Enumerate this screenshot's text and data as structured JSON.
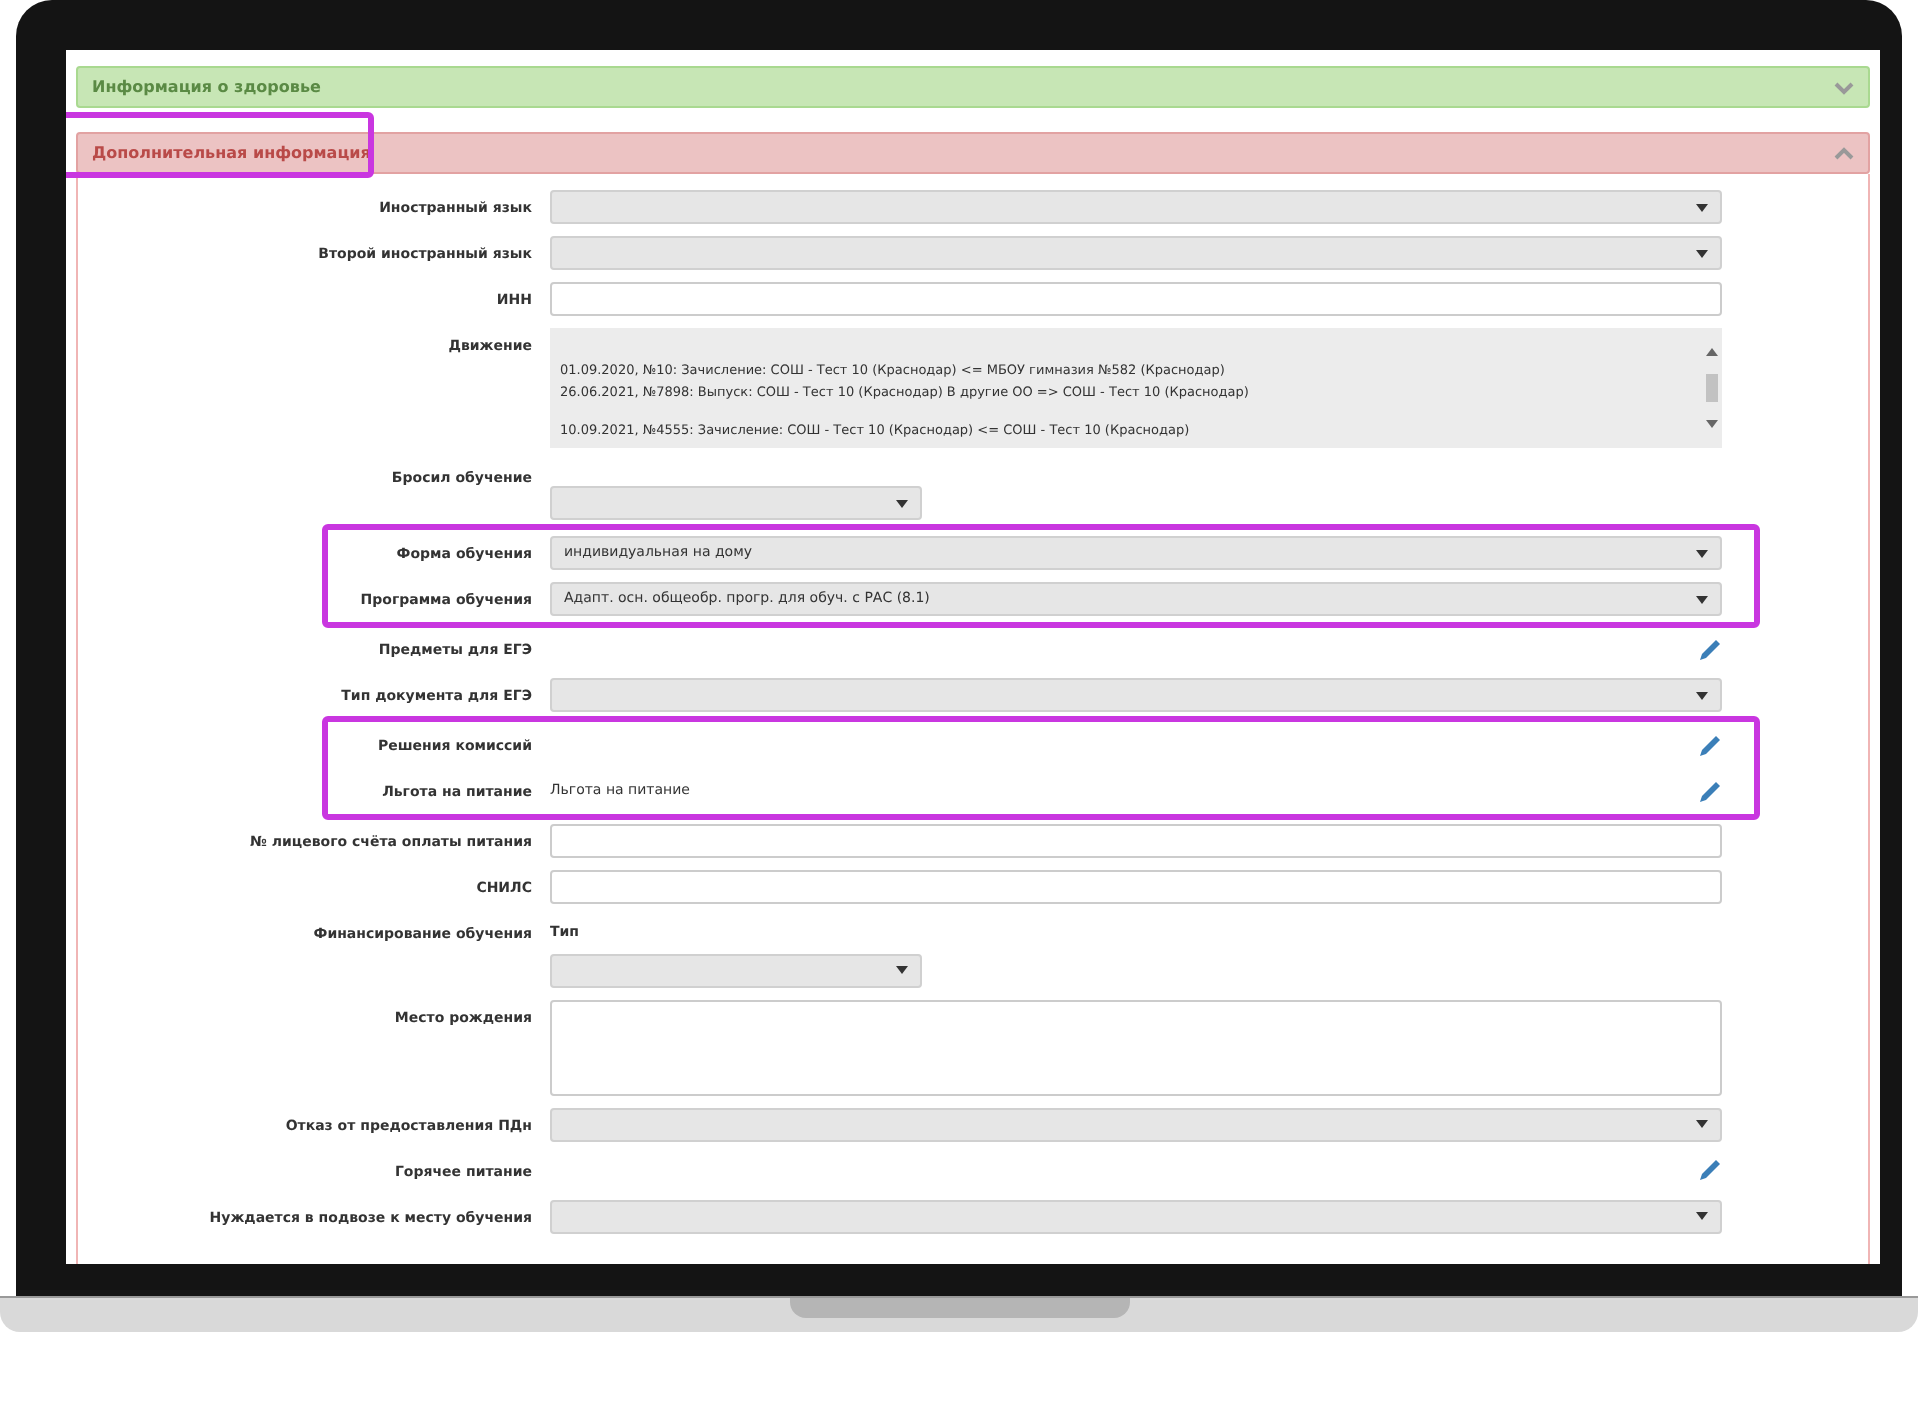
{
  "panels": [
    {
      "title": "Информация о здоровье",
      "color": "#c7e6b5",
      "expanded": false,
      "highlighted": false
    },
    {
      "title": "Дополнительная информация",
      "color": "#ecc3c3",
      "expanded": true,
      "highlighted": true,
      "row_groups": [
        {
          "highlighted": false,
          "rows": [
            {
              "kind": "select",
              "label": "Иностранный язык"
            },
            {
              "kind": "select",
              "label": "Второй иностранный язык"
            },
            {
              "kind": "input",
              "label": "ИНН"
            },
            {
              "kind": "movement",
              "label": "Движение",
              "blocks": [
                {
                  "lines": [
                    "01.09.2020, №10: Зачисление: СОШ - Тест 10 (Краснодар)  <= МБОУ гимназия №582 (Краснодар)",
                    "26.06.2021, №7898: Выпуск: СОШ - Тест 10 (Краснодар) В другие ОО => СОШ - Тест 10 (Краснодар)"
                  ]
                },
                {
                  "lines": [
                    "10.09.2021, №4555: Зачисление: СОШ - Тест 10 (Краснодар)  <= СОШ - Тест 10 (Краснодар)"
                  ]
                }
              ]
            },
            {
              "kind": "select-stacked",
              "label": "Бросил обучение"
            }
          ]
        },
        {
          "highlighted": true,
          "rows": [
            {
              "kind": "select",
              "label": "Форма обучения",
              "value": "индивидуальная на дому"
            },
            {
              "kind": "select",
              "label": "Программа обучения",
              "value": "Адапт. осн. общеобр. прогр. для обуч. с РАС (8.1)"
            }
          ]
        },
        {
          "highlighted": false,
          "rows": [
            {
              "kind": "edit",
              "label": "Предметы для ЕГЭ"
            },
            {
              "kind": "select",
              "label": "Тип документа для ЕГЭ"
            }
          ]
        },
        {
          "highlighted": true,
          "rows": [
            {
              "kind": "edit",
              "label": "Решения комиссий"
            },
            {
              "kind": "edit",
              "label": "Льгота на питание",
              "value": "Льгота на питание"
            }
          ]
        },
        {
          "highlighted": false,
          "rows": [
            {
              "kind": "input",
              "label": "№ лицевого счёта оплаты питания"
            },
            {
              "kind": "input",
              "label": "СНИЛС"
            },
            {
              "kind": "select-captioned",
              "label": "Финансирование обучения",
              "caption": "Тип"
            },
            {
              "kind": "textarea",
              "label": "Место рождения"
            },
            {
              "kind": "select",
              "label": "Отказ от предоставления ПДн"
            },
            {
              "kind": "edit",
              "label": "Горячее питание"
            },
            {
              "kind": "select",
              "label": "Нуждается в подвозе к месту обучения"
            }
          ]
        }
      ]
    }
  ]
}
